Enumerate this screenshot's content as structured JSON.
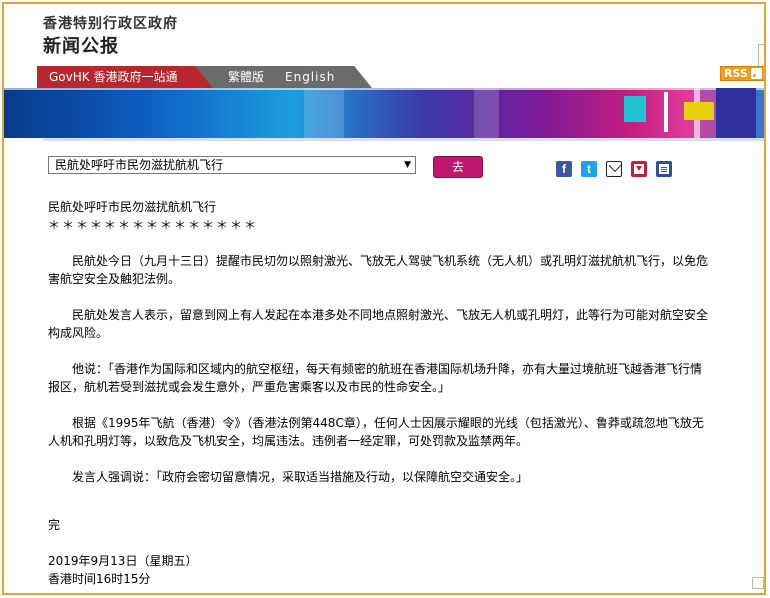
{
  "header": {
    "hk_title": "香港特别行政区政府",
    "press_title": "新闻公报"
  },
  "nav": {
    "govhk_label": "GovHK 香港政府一站通",
    "traditional_label": "繁體版",
    "english_label": "English",
    "rss_label": "RSS"
  },
  "selector": {
    "selected": "民航处呼吁市民勿滋扰航机飞行",
    "go_label": "去"
  },
  "share": {
    "facebook": "f",
    "twitter": "t",
    "icons": [
      "facebook-icon",
      "twitter-icon",
      "email-icon",
      "download-icon",
      "print-icon"
    ]
  },
  "article": {
    "heading": "民航处呼吁市民勿滋扰航机飞行",
    "stars": "＊＊＊＊＊＊＊＊＊＊＊＊＊＊＊",
    "paragraphs": [
      "民航处今日（九月十三日）提醒市民切勿以照射激光、飞放无人驾驶飞机系统（无人机）或孔明灯滋扰航机飞行，以免危害航空安全及触犯法例。",
      "民航处发言人表示，留意到网上有人发起在本港多处不同地点照射激光、飞放无人机或孔明灯，此等行为可能对航空安全构成风险。",
      "他说：「香港作为国际和区域内的航空枢纽，每天有频密的航班在香港国际机场升降，亦有大量过境航班飞越香港飞行情报区，航机若受到滋扰或会发生意外，严重危害乘客以及市民的性命安全。」",
      "根据《1995年飞航（香港）令》（香港法例第448C章），任何人士因展示耀眼的光线（包括激光）、鲁莽或疏忽地飞放无人机和孔明灯等，以致危及飞机安全，均属违法。违例者一经定罪，可处罚款及监禁两年。",
      "发言人强调说：「政府会密切留意情况，采取适当措施及行动，以保障航空交通安全。」"
    ],
    "end": "完",
    "date": "2019年9月13日（星期五）",
    "time": "香港时间16时15分"
  },
  "colors": {
    "frame": "#f0a030",
    "govhk": "#b8272d",
    "go_button": "#c0176e",
    "rss": "#f39b1a"
  }
}
